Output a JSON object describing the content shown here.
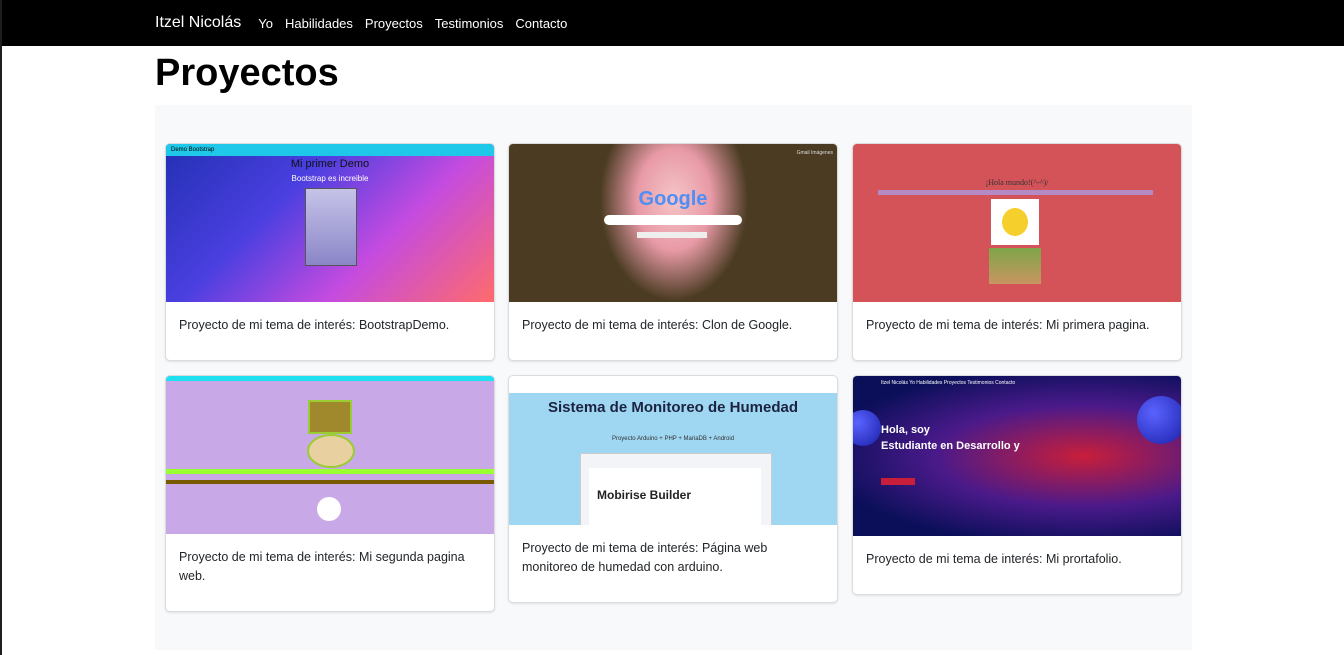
{
  "navbar": {
    "brand": "Itzel Nicolás",
    "links": [
      "Yo",
      "Habilidades",
      "Proyectos",
      "Testimonios",
      "Contacto"
    ]
  },
  "page_title": "Proyectos",
  "projects": [
    {
      "description": "Proyecto de mi tema de interés: BootstrapDemo.",
      "thumb": {
        "bar": "Demo Bootstrap",
        "heading": "Mi primer Demo",
        "sub": "Bootstrap es increible"
      }
    },
    {
      "description": "Proyecto de mi tema de interés: Clon de Google.",
      "thumb": {
        "logo": "Google",
        "top": "Gmail  Imágenes"
      }
    },
    {
      "description": "Proyecto de mi tema de interés: Mi primera pagina.",
      "thumb": {
        "heading": "¡Hola mundo!(^-^)/"
      }
    },
    {
      "description": "Proyecto de mi tema de interés: Mi segunda pagina web.",
      "thumb": {}
    },
    {
      "description": "Proyecto de mi tema de interés: Página web monitoreo de humedad con arduino.",
      "thumb": {
        "heading": "Sistema de Monitoreo de Humedad",
        "sub": "Proyecto Arduino + PHP + MariaDB + Android",
        "builder": "Mobirise Builder"
      }
    },
    {
      "description": "Proyecto de mi tema de interés: Mi prortafolio.",
      "thumb": {
        "nav": "Itzel Nicolás  Yo  Habilidades  Proyectos  Testimonios  Contacto",
        "line1": "Hola, soy",
        "line2": "Estudiante en Desarrollo y"
      }
    }
  ]
}
